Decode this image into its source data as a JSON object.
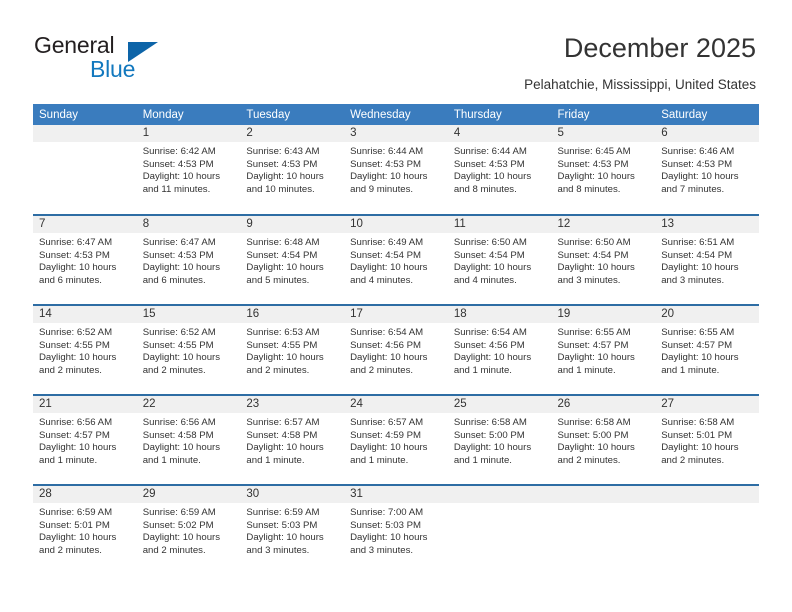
{
  "brand": {
    "name_top": "General",
    "name_bottom": "Blue",
    "triangle_icon": "triangle-icon",
    "color_dark": "#231f20",
    "color_blue": "#1278be"
  },
  "header": {
    "title": "December 2025",
    "subtitle": "Pelahatchie, Mississippi, United States"
  },
  "theme": {
    "header_row_bg": "#3a7cbe",
    "row_divider": "#2e6da4",
    "daynum_bg": "#f0f0f0",
    "text": "#333333"
  },
  "calendar": {
    "weekdays": [
      "Sunday",
      "Monday",
      "Tuesday",
      "Wednesday",
      "Thursday",
      "Friday",
      "Saturday"
    ],
    "weeks": [
      [
        {
          "day": "",
          "sunrise": "",
          "sunset": "",
          "daylight": "",
          "blank": true
        },
        {
          "day": "1",
          "sunrise": "Sunrise: 6:42 AM",
          "sunset": "Sunset: 4:53 PM",
          "daylight": "Daylight: 10 hours and 11 minutes."
        },
        {
          "day": "2",
          "sunrise": "Sunrise: 6:43 AM",
          "sunset": "Sunset: 4:53 PM",
          "daylight": "Daylight: 10 hours and 10 minutes."
        },
        {
          "day": "3",
          "sunrise": "Sunrise: 6:44 AM",
          "sunset": "Sunset: 4:53 PM",
          "daylight": "Daylight: 10 hours and 9 minutes."
        },
        {
          "day": "4",
          "sunrise": "Sunrise: 6:44 AM",
          "sunset": "Sunset: 4:53 PM",
          "daylight": "Daylight: 10 hours and 8 minutes."
        },
        {
          "day": "5",
          "sunrise": "Sunrise: 6:45 AM",
          "sunset": "Sunset: 4:53 PM",
          "daylight": "Daylight: 10 hours and 8 minutes."
        },
        {
          "day": "6",
          "sunrise": "Sunrise: 6:46 AM",
          "sunset": "Sunset: 4:53 PM",
          "daylight": "Daylight: 10 hours and 7 minutes."
        }
      ],
      [
        {
          "day": "7",
          "sunrise": "Sunrise: 6:47 AM",
          "sunset": "Sunset: 4:53 PM",
          "daylight": "Daylight: 10 hours and 6 minutes."
        },
        {
          "day": "8",
          "sunrise": "Sunrise: 6:47 AM",
          "sunset": "Sunset: 4:53 PM",
          "daylight": "Daylight: 10 hours and 6 minutes."
        },
        {
          "day": "9",
          "sunrise": "Sunrise: 6:48 AM",
          "sunset": "Sunset: 4:54 PM",
          "daylight": "Daylight: 10 hours and 5 minutes."
        },
        {
          "day": "10",
          "sunrise": "Sunrise: 6:49 AM",
          "sunset": "Sunset: 4:54 PM",
          "daylight": "Daylight: 10 hours and 4 minutes."
        },
        {
          "day": "11",
          "sunrise": "Sunrise: 6:50 AM",
          "sunset": "Sunset: 4:54 PM",
          "daylight": "Daylight: 10 hours and 4 minutes."
        },
        {
          "day": "12",
          "sunrise": "Sunrise: 6:50 AM",
          "sunset": "Sunset: 4:54 PM",
          "daylight": "Daylight: 10 hours and 3 minutes."
        },
        {
          "day": "13",
          "sunrise": "Sunrise: 6:51 AM",
          "sunset": "Sunset: 4:54 PM",
          "daylight": "Daylight: 10 hours and 3 minutes."
        }
      ],
      [
        {
          "day": "14",
          "sunrise": "Sunrise: 6:52 AM",
          "sunset": "Sunset: 4:55 PM",
          "daylight": "Daylight: 10 hours and 2 minutes."
        },
        {
          "day": "15",
          "sunrise": "Sunrise: 6:52 AM",
          "sunset": "Sunset: 4:55 PM",
          "daylight": "Daylight: 10 hours and 2 minutes."
        },
        {
          "day": "16",
          "sunrise": "Sunrise: 6:53 AM",
          "sunset": "Sunset: 4:55 PM",
          "daylight": "Daylight: 10 hours and 2 minutes."
        },
        {
          "day": "17",
          "sunrise": "Sunrise: 6:54 AM",
          "sunset": "Sunset: 4:56 PM",
          "daylight": "Daylight: 10 hours and 2 minutes."
        },
        {
          "day": "18",
          "sunrise": "Sunrise: 6:54 AM",
          "sunset": "Sunset: 4:56 PM",
          "daylight": "Daylight: 10 hours and 1 minute."
        },
        {
          "day": "19",
          "sunrise": "Sunrise: 6:55 AM",
          "sunset": "Sunset: 4:57 PM",
          "daylight": "Daylight: 10 hours and 1 minute."
        },
        {
          "day": "20",
          "sunrise": "Sunrise: 6:55 AM",
          "sunset": "Sunset: 4:57 PM",
          "daylight": "Daylight: 10 hours and 1 minute."
        }
      ],
      [
        {
          "day": "21",
          "sunrise": "Sunrise: 6:56 AM",
          "sunset": "Sunset: 4:57 PM",
          "daylight": "Daylight: 10 hours and 1 minute."
        },
        {
          "day": "22",
          "sunrise": "Sunrise: 6:56 AM",
          "sunset": "Sunset: 4:58 PM",
          "daylight": "Daylight: 10 hours and 1 minute."
        },
        {
          "day": "23",
          "sunrise": "Sunrise: 6:57 AM",
          "sunset": "Sunset: 4:58 PM",
          "daylight": "Daylight: 10 hours and 1 minute."
        },
        {
          "day": "24",
          "sunrise": "Sunrise: 6:57 AM",
          "sunset": "Sunset: 4:59 PM",
          "daylight": "Daylight: 10 hours and 1 minute."
        },
        {
          "day": "25",
          "sunrise": "Sunrise: 6:58 AM",
          "sunset": "Sunset: 5:00 PM",
          "daylight": "Daylight: 10 hours and 1 minute."
        },
        {
          "day": "26",
          "sunrise": "Sunrise: 6:58 AM",
          "sunset": "Sunset: 5:00 PM",
          "daylight": "Daylight: 10 hours and 2 minutes."
        },
        {
          "day": "27",
          "sunrise": "Sunrise: 6:58 AM",
          "sunset": "Sunset: 5:01 PM",
          "daylight": "Daylight: 10 hours and 2 minutes."
        }
      ],
      [
        {
          "day": "28",
          "sunrise": "Sunrise: 6:59 AM",
          "sunset": "Sunset: 5:01 PM",
          "daylight": "Daylight: 10 hours and 2 minutes."
        },
        {
          "day": "29",
          "sunrise": "Sunrise: 6:59 AM",
          "sunset": "Sunset: 5:02 PM",
          "daylight": "Daylight: 10 hours and 2 minutes."
        },
        {
          "day": "30",
          "sunrise": "Sunrise: 6:59 AM",
          "sunset": "Sunset: 5:03 PM",
          "daylight": "Daylight: 10 hours and 3 minutes."
        },
        {
          "day": "31",
          "sunrise": "Sunrise: 7:00 AM",
          "sunset": "Sunset: 5:03 PM",
          "daylight": "Daylight: 10 hours and 3 minutes."
        },
        {
          "day": "",
          "sunrise": "",
          "sunset": "",
          "daylight": "",
          "blank": true
        },
        {
          "day": "",
          "sunrise": "",
          "sunset": "",
          "daylight": "",
          "blank": true
        },
        {
          "day": "",
          "sunrise": "",
          "sunset": "",
          "daylight": "",
          "blank": true
        }
      ]
    ]
  }
}
